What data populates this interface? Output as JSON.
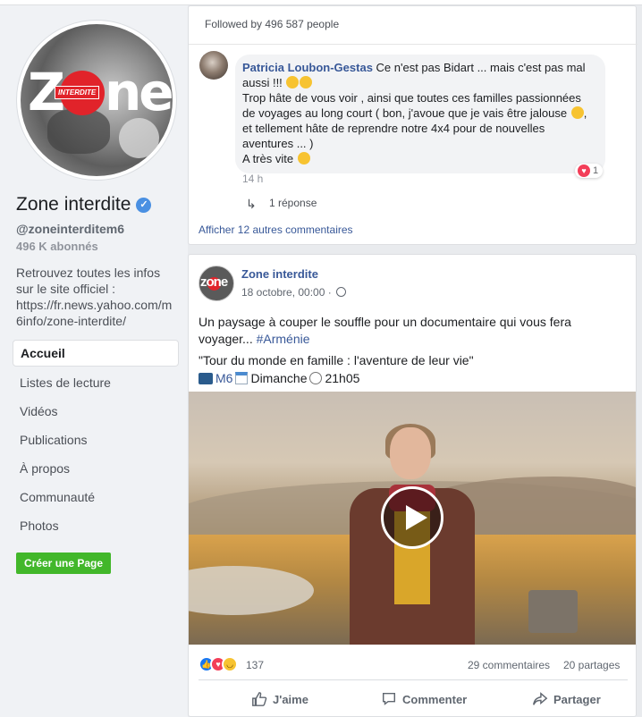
{
  "page": {
    "name": "Zone interdite",
    "handle": "@zoneinterditem6",
    "subscribers": "496 K abonnés",
    "about": "Retrouvez toutes les infos sur le site officiel : https://fr.news.yahoo.com/m6info/zone-interdite/",
    "logo_text_left": "Z",
    "logo_text_right": "ne",
    "logo_badge": "INTERDITE",
    "verified_glyph": "✓"
  },
  "nav": {
    "items": [
      "Accueil",
      "Listes de lecture",
      "Vidéos",
      "Publications",
      "À propos",
      "Communauté",
      "Photos"
    ],
    "active": "Accueil"
  },
  "create_page_label": "Créer une Page",
  "followed": "Followed by 496 587 people",
  "comment": {
    "author": "Patricia Loubon-Gestas",
    "line1": " Ce n'est pas Bidart ... mais c'est pas mal aussi !!! ",
    "line2": "Trop hâte de vous voir , ainsi que toutes ces familles passionnées de voyages au long court ( bon, j'avoue que je vais être jalouse ",
    "line3": ", et tellement hâte de reprendre notre 4x4 pour de nouvelles aventures ... )",
    "line4": "A très vite ",
    "time": "14 h",
    "reaction_count": "1",
    "reply_label": "1 réponse",
    "more_comments": "Afficher 12 autres commentaires"
  },
  "post": {
    "author": "Zone interdite",
    "date": "18 octobre, 00:00 · ",
    "avatar_text": "zone",
    "text": "Un paysage à couper le souffle pour un documentaire qui vous fera voyager... ",
    "hashtag": "#Arménie",
    "title": "\"Tour du monde en famille : l'aventure de leur vie\"",
    "channel": "M6",
    "day": "Dimanche",
    "time": "21h05",
    "reactions": "137",
    "comments": "29 commentaires",
    "shares": "20 partages",
    "like_label": "J'aime",
    "comment_label": "Commenter",
    "share_label": "Partager"
  },
  "colors": {
    "link_blue": "#385898",
    "green_button": "#42b72a",
    "brand_red": "#e1232a",
    "background": "#e9ebee"
  }
}
